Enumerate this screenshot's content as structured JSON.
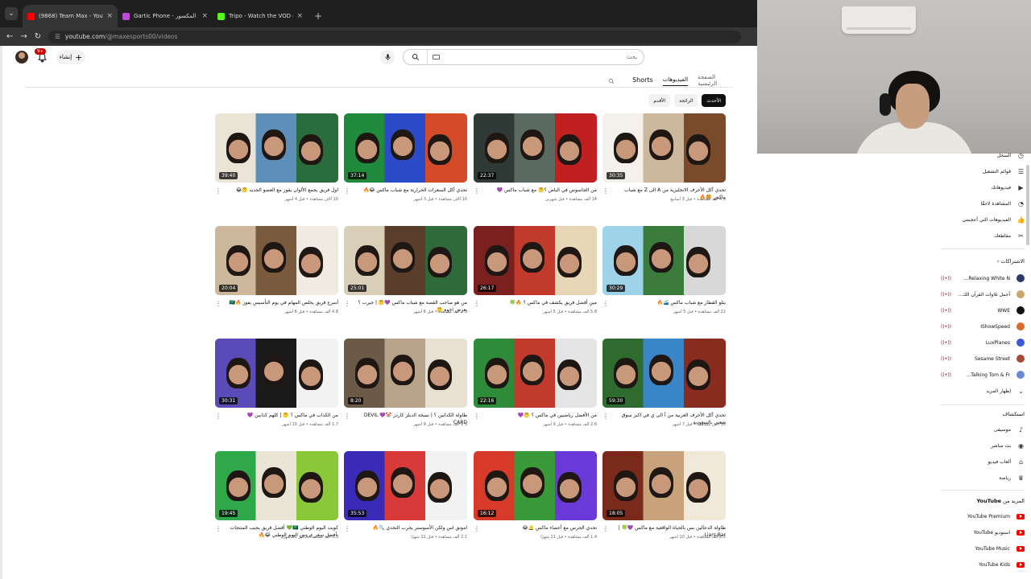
{
  "browser": {
    "tabs": [
      {
        "title": "(9868) Team Max - YouTube",
        "active": true,
        "favicon_color": "#ff0000"
      },
      {
        "title": "Gartic Phone - الهاتف المكسور",
        "active": false,
        "favicon_color": "#c04ad6"
      },
      {
        "title": "Tripo - Watch the VOD on Kick",
        "active": false,
        "favicon_color": "#53fc18"
      }
    ],
    "url_host": "youtube.com",
    "url_path": "/@maxesports00/videos"
  },
  "masthead": {
    "notification_count": "9+",
    "create_label": "إنشاء",
    "search_placeholder": "بحث"
  },
  "channel_tabs": [
    {
      "label": "الصفحة الرئيسية",
      "active": false
    },
    {
      "label": "الفيديوهات",
      "active": true
    },
    {
      "label": "Shorts",
      "active": false
    }
  ],
  "chips": [
    {
      "label": "الأحدث",
      "active": true
    },
    {
      "label": "الرائجة",
      "active": false
    },
    {
      "label": "الأقدم",
      "active": false
    }
  ],
  "videos": [
    {
      "title": "تحدي أكل الأحرف الانجليزية من A الى Z مع شباب ماكس 🍔🔥",
      "meta1": "4.9 ألف مشاهدة • قبل 3 أسابيع",
      "meta2": "",
      "duration": "30:35",
      "colors": [
        "#f4f1ec",
        "#cbb89d",
        "#7a4b2a"
      ]
    },
    {
      "title": "من الجاسوس في الباص ؟🤔 مع شباب ماكس 💜",
      "meta1": "14 ألف مشاهدة • قبل شهرين",
      "meta2": "",
      "duration": "22:37",
      "colors": [
        "#2f3a36",
        "#5b6b62",
        "#c02020"
      ]
    },
    {
      "title": "تحدي أكل السعرات الحرارية مع شباب ماكس 😂🔥",
      "meta1": "10 آلاف مشاهدة • قبل 3 أشهر",
      "meta2": "",
      "duration": "37:14",
      "colors": [
        "#1f8a3b",
        "#2c4bc8",
        "#d44b2a"
      ]
    },
    {
      "title": "اول فريق يجمع الألوان يفوز مع العضو الجديد 🤔😂",
      "meta1": "10 آلاف مشاهدة • قبل 4 أشهر",
      "meta2": "",
      "duration": "39:40",
      "colors": [
        "#e9e4d6",
        "#5e8fb8",
        "#2a6d3c"
      ]
    },
    {
      "title": "يتلو القطار مع شباب ماكس 🚄🔥",
      "meta1": "22 ألف مشاهدة • قبل 5 أشهر",
      "meta2": "",
      "duration": "30:29",
      "colors": [
        "#9fd3ea",
        "#3b7c3c",
        "#d8d8d8"
      ]
    },
    {
      "title": "مين أفضل فريق يكشف في ماكس ؟ 🔥🍀",
      "meta1": "5.8 ألف مشاهدة • قبل 5 أشهر",
      "meta2": "",
      "duration": "26:17",
      "colors": [
        "#7b1f1f",
        "#c23a2b",
        "#e7d7b6"
      ]
    },
    {
      "title": "من هو صاحب القصة مع شباب ماكس 💜🤔 | جيرب ؟ يعرض اخوه 🤔",
      "meta1": "2.5 ألف مشاهدة • قبل 6 أشهر",
      "meta2": "",
      "duration": "25:01",
      "colors": [
        "#d9cfb8",
        "#5a3d2a",
        "#2f6b3a"
      ]
    },
    {
      "title": "أسرع فريق يخلص المهام في يوم التأسيس يفوز 🔥🇸🇦",
      "meta1": "4.8 ألف مشاهدة • قبل 6 أشهر",
      "meta2": "",
      "duration": "20:04",
      "colors": [
        "#cdb79a",
        "#7a5a3c",
        "#f1ece3"
      ]
    },
    {
      "title": "تحدي أكل الأحرف العربية من أ الى ي في اكبر سوق شعبي بالسعودية",
      "meta1": "10 آلاف مشاهدة • قبل 7 أشهر",
      "meta2": "",
      "duration": "59:30",
      "colors": [
        "#2f6b2f",
        "#3a84c8",
        "#8a2b1f"
      ]
    },
    {
      "title": "من الأفضل رياضيين في ماكس ؟ 🤔💜",
      "meta1": "2.6 ألف مشاهدة • قبل 9 أشهر",
      "meta2": "",
      "duration": "22:16",
      "colors": [
        "#2e8b3a",
        "#c23a2b",
        "#e5e5e5"
      ]
    },
    {
      "title": "طاولة الكذابين ؟ | نسخة الديلز كاردز 🤡💜 DEVIL CARD",
      "meta1": "1.3 ألف مشاهدة • قبل 9 أشهر",
      "meta2": "",
      "duration": "8:20",
      "colors": [
        "#6b5a48",
        "#b8a48a",
        "#e8e0d0"
      ]
    },
    {
      "title": "من الكذاب في ماكس ؟ 🤔 | كلهم كذابين 💜",
      "meta1": "1.7 ألف مشاهدة • قبل 10 أشهر",
      "meta2": "",
      "duration": "30:31",
      "colors": [
        "#5a4bb8",
        "#1a1a1a",
        "#f2f2f2"
      ]
    },
    {
      "title": "طاولة الدجالين بس بالحياة الواقعية مع ماكس 💜🍀 | Liars Bar",
      "meta1": "2.2 ألف مشاهدة • قبل 10 أشهر",
      "meta2": "",
      "duration": "18:05",
      "colors": [
        "#7a2a1a",
        "#c8a27a",
        "#f0e8d8"
      ]
    },
    {
      "title": "تحدي الجرس مع أعضاء ماكس 🔔😂",
      "meta1": "1.4 ألف مشاهدة • قبل 11 شهرًا",
      "meta2": "",
      "duration": "16:12",
      "colors": [
        "#d83a2a",
        "#3a9a3a",
        "#6a3ad8"
      ]
    },
    {
      "title": "امونق اس ولكن الأمبوستر يخرب التحدي 🔍🔥",
      "meta1": "2.1 ألف مشاهدة • قبل 11 شهرًا",
      "meta2": "",
      "duration": "35:53",
      "colors": [
        "#3a2ab8",
        "#d83a3a",
        "#f2f2f2"
      ]
    },
    {
      "title": "كويت اليوم الوطني 🇸🇦💚 أفضل فريق يجيب المنتجات بأفضل سعر عروض اليوم الوطني 😂🔥",
      "meta1": "5.3 ألف مشاهدة • قبل 11 شهرًا",
      "meta2": "",
      "duration": "19:45",
      "colors": [
        "#2fa84a",
        "#e9e4d6",
        "#8ac83a"
      ]
    }
  ],
  "sidebar": {
    "you_items": [
      {
        "label": "السجل",
        "icon": "history-icon"
      },
      {
        "label": "قوائم التشغيل",
        "icon": "playlist-icon"
      },
      {
        "label": "فيديوهاتك",
        "icon": "your-videos-icon"
      },
      {
        "label": "المشاهدة لاحقًا",
        "icon": "watch-later-icon"
      },
      {
        "label": "الفيديوهات التي أعجبتني",
        "icon": "like-icon"
      },
      {
        "label": "مقاطعك",
        "icon": "clips-icon"
      }
    ],
    "subs_header": "الاشتراكات",
    "subscriptions": [
      {
        "label": "Relaxing White N...",
        "color": "#2a3a6a"
      },
      {
        "label": "أجمل تلاوات القرآن الك...",
        "color": "#c8a86a"
      },
      {
        "label": "WWE",
        "color": "#111111"
      },
      {
        "label": "IShowSpeed",
        "color": "#d86a2a"
      },
      {
        "label": "LuxPlanes",
        "color": "#3a5ad8"
      },
      {
        "label": "Sesame Street",
        "color": "#a84a3a"
      },
      {
        "label": "Talking Tom & Fr...",
        "color": "#6a8ad8"
      }
    ],
    "show_more": "إظهار المزيد",
    "explore_header": "استكشاف",
    "explore": [
      {
        "label": "موسيقى",
        "icon": "music-icon"
      },
      {
        "label": "بث مباشر",
        "icon": "live-icon"
      },
      {
        "label": "ألعاب فيديو",
        "icon": "gaming-icon"
      },
      {
        "label": "رياضة",
        "icon": "trophy-icon"
      }
    ],
    "more_header_prefix": "المزيد من",
    "more_header_brand": "YouTube",
    "more": [
      {
        "label": "YouTube Premium"
      },
      {
        "label": "استوديو YouTube"
      },
      {
        "label": "YouTube Music"
      },
      {
        "label": "YouTube Kids"
      }
    ]
  }
}
